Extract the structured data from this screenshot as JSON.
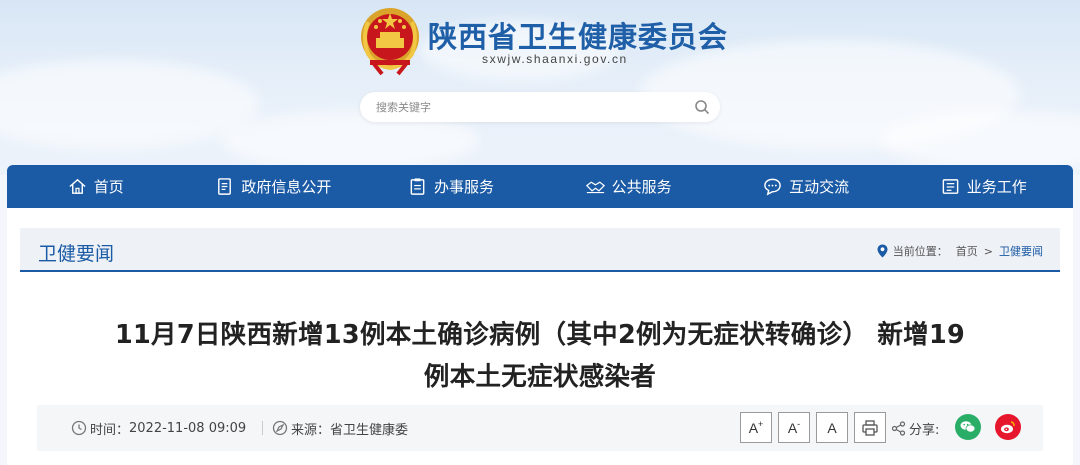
{
  "header": {
    "site_title": "陕西省卫生健康委员会",
    "site_domain": "sxwjw.shaanxi.gov.cn",
    "emblem_icon": "national-emblem-icon"
  },
  "search": {
    "placeholder": "搜索关键字",
    "button_icon": "search-icon"
  },
  "nav": {
    "items": [
      {
        "label": "首页",
        "icon": "home-icon"
      },
      {
        "label": "政府信息公开",
        "icon": "document-list-icon"
      },
      {
        "label": "办事服务",
        "icon": "clipboard-icon"
      },
      {
        "label": "公共服务",
        "icon": "handshake-icon"
      },
      {
        "label": "互动交流",
        "icon": "chat-icon"
      },
      {
        "label": "业务工作",
        "icon": "briefcase-icon"
      }
    ]
  },
  "section": {
    "title": "卫健要闻",
    "breadcrumb_label": "当前位置：",
    "breadcrumb": [
      "首页",
      "卫健要闻"
    ],
    "breadcrumb_sep": ">"
  },
  "article": {
    "title_line1": "11月7日陕西新增13例本土确诊病例（其中2例为无症状转确诊） 新增19",
    "title_line2": "例本土无症状感染者",
    "time_label": "时间：",
    "time_value": "2022-11-08 09:09",
    "source_label": "来源：",
    "source_value": "省卫生健康委"
  },
  "toolbar": {
    "font_larger": "A",
    "font_smaller": "A",
    "font_default": "A",
    "print_icon": "print-icon",
    "share_label": "分享:",
    "share_icon": "share-icon",
    "wechat_icon": "wechat-icon",
    "weibo_icon": "weibo-icon"
  },
  "colors": {
    "brand_blue": "#1b5aa5",
    "wechat_green": "#2aae67",
    "weibo_red": "#e6162d"
  }
}
